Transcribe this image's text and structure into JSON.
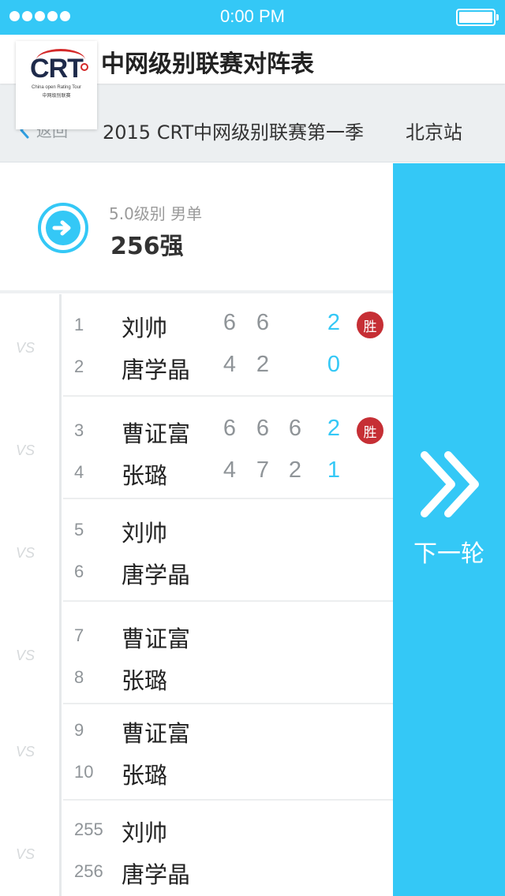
{
  "status_bar": {
    "time": "0:00 PM"
  },
  "header": {
    "app_title": "中网级别联赛对阵表",
    "logo": {
      "mark": "CRT",
      "english": "China open Rating Tour",
      "chinese": "中网级别联赛"
    }
  },
  "nav": {
    "back_label": "返回",
    "season": "2015 CRT中网级别联赛第一季",
    "station": "北京站"
  },
  "round": {
    "category": "5.0级别 男单",
    "title": "256强",
    "icon": "arrow-right-circle-icon"
  },
  "vs_label": "VS",
  "matches": [
    {
      "players": [
        {
          "seed": "1",
          "name": "刘帅",
          "scores": [
            "6",
            "6",
            ""
          ],
          "total": "2",
          "winner": true
        },
        {
          "seed": "2",
          "name": "唐学晶",
          "scores": [
            "4",
            "2",
            ""
          ],
          "total": "0",
          "winner": false
        }
      ]
    },
    {
      "players": [
        {
          "seed": "3",
          "name": "曹证富",
          "scores": [
            "6",
            "6",
            "6"
          ],
          "total": "2",
          "winner": true
        },
        {
          "seed": "4",
          "name": "张璐",
          "scores": [
            "4",
            "7",
            "2"
          ],
          "total": "1",
          "winner": false
        }
      ]
    },
    {
      "players": [
        {
          "seed": "5",
          "name": "刘帅",
          "scores": [
            "",
            "",
            ""
          ],
          "total": "",
          "winner": false
        },
        {
          "seed": "6",
          "name": "唐学晶",
          "scores": [
            "",
            "",
            ""
          ],
          "total": "",
          "winner": false
        }
      ]
    },
    {
      "players": [
        {
          "seed": "7",
          "name": "曹证富",
          "scores": [
            "",
            "",
            ""
          ],
          "total": "",
          "winner": false
        },
        {
          "seed": "8",
          "name": "张璐",
          "scores": [
            "",
            "",
            ""
          ],
          "total": "",
          "winner": false
        }
      ]
    },
    {
      "players": [
        {
          "seed": "9",
          "name": "曹证富",
          "scores": [
            "",
            "",
            ""
          ],
          "total": "",
          "winner": false
        },
        {
          "seed": "10",
          "name": "张璐",
          "scores": [
            "",
            "",
            ""
          ],
          "total": "",
          "winner": false
        }
      ]
    },
    {
      "players": [
        {
          "seed": "255",
          "name": "刘帅",
          "scores": [
            "",
            "",
            ""
          ],
          "total": "",
          "winner": false
        },
        {
          "seed": "256",
          "name": "唐学晶",
          "scores": [
            "",
            "",
            ""
          ],
          "total": "",
          "winner": false
        }
      ]
    }
  ],
  "win_badge": "胜",
  "next_round": {
    "label": "下一轮",
    "icon": "double-chevron-right-icon"
  },
  "colors": {
    "accent": "#34c8f6",
    "win_badge": "#c62f35",
    "subheader_bg": "#eceff1"
  }
}
